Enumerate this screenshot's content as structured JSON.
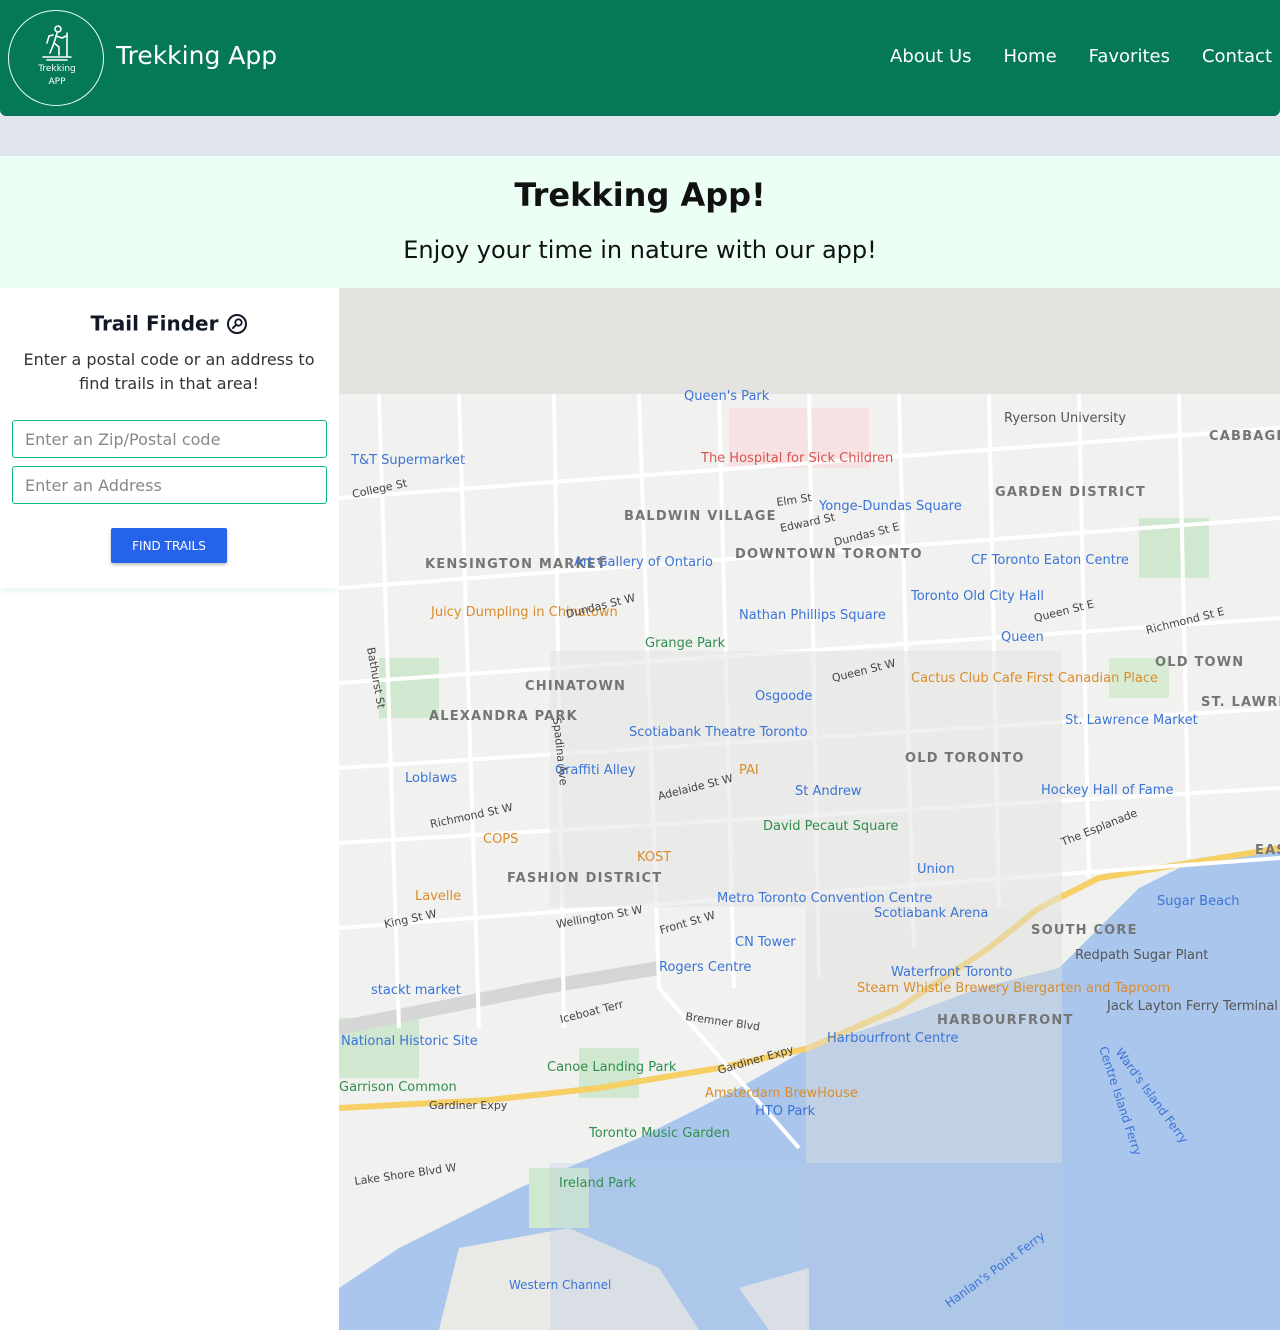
{
  "header": {
    "logo_line1": "Trekking",
    "logo_line2": "APP",
    "brand": "Trekking App",
    "nav": [
      "About Us",
      "Home",
      "Favorites",
      "Contact"
    ]
  },
  "hero": {
    "title": "Trekking App!",
    "subtitle": "Enjoy your time in nature with our app!"
  },
  "sidebar": {
    "title": "Trail Finder",
    "description": "Enter a postal code or an address to find trails in that area!",
    "zip_placeholder": "Enter an Zip/Postal code",
    "address_placeholder": "Enter an Address",
    "button": "FIND TRAILS"
  },
  "map": {
    "labels": {
      "queens_park": "Queen's Park",
      "ryerson": "Ryerson University",
      "cabbagetown": "CABBAGETOWN SOUTH",
      "tt_supermarket": "T&T Supermarket",
      "hospital_sick": "The Hospital for Sick Children",
      "college_st": "College St",
      "elm_st": "Elm St",
      "baldwin": "BALDWIN VILLAGE",
      "yonge_dundas": "Yonge-Dundas Square",
      "garden_district": "GARDEN DISTRICT",
      "kensington": "KENSINGTON MARKET",
      "downtown": "DOWNTOWN TORONTO",
      "ago": "Art Gallery of Ontario",
      "eaton": "CF Toronto Eaton Centre",
      "juicy": "Juicy Dumpling in Chinatown",
      "old_city_hall": "Toronto Old City Hall",
      "nathan_phillips": "Nathan Phillips Square",
      "grange_park": "Grange Park",
      "queen_station": "Queen",
      "old_town": "OLD TOWN",
      "chinatown": "CHINATOWN",
      "cactus": "Cactus Club Cafe First Canadian Place",
      "st_lawrence": "ST. LAWRENCE",
      "alexandra_park": "ALEXANDRA PARK",
      "osgoode": "Osgoode",
      "st_lawrence_market": "St. Lawrence Market",
      "scotiabank_theatre": "Scotiabank Theatre Toronto",
      "old_toronto": "OLD TORONTO",
      "loblaws": "Loblaws",
      "graffiti": "Graffiti Alley",
      "pai": "PAI",
      "hockey": "Hockey Hall of Fame",
      "st_andrew": "St Andrew",
      "richmond": "Richmond St W",
      "cops": "COPS",
      "david_pecaut": "David Pecaut Square",
      "kost": "KOST",
      "union": "Union",
      "east": "EAST",
      "fashion": "FASHION DISTRICT",
      "lavelle": "Lavelle",
      "sugar_beach": "Sugar Beach",
      "metro": "Metro Toronto Convention Centre",
      "scotiabank_arena": "Scotiabank Arena",
      "south_core": "SOUTH CORE",
      "king_st": "King St W",
      "cn_tower": "CN Tower",
      "redpath": "Redpath Sugar Plant",
      "rogers": "Rogers Centre",
      "waterfront": "Waterfront Toronto",
      "stackt": "stackt market",
      "steam_whistle": "Steam Whistle Brewery Biergarten and Taproom",
      "jack_layton": "Jack Layton Ferry Terminal",
      "harbourfront": "HARBOURFRONT",
      "national": "National Historic Site",
      "harbourfront_centre": "Harbourfront Centre",
      "canoe": "Canoe Landing Park",
      "garrison": "Garrison Common",
      "gardiner": "Gardiner Expy",
      "amsterdam": "Amsterdam BrewHouse",
      "hto": "HTO Park",
      "music_garden": "Toronto Music Garden",
      "lakeshore": "Lake Shore Blvd W",
      "ireland_park": "Ireland Park",
      "western_channel": "Western Channel",
      "bremner": "Bremner Blvd",
      "front_st": "Front St W",
      "dundas_st": "Dundas St W",
      "queen_st": "Queen St W",
      "adelaide": "Adelaide St W",
      "wellington": "Wellington St W",
      "queen_e": "Queen St E",
      "richmond_e": "Richmond St E",
      "dundas_e": "Dundas St E",
      "hanlans": "Hanlan's Point Ferry",
      "wards": "Ward's Island Ferry",
      "centre_island": "Centre Island Ferry",
      "bathurst": "Bathurst St",
      "spadina": "Spadina Ave",
      "edward": "Edward St",
      "iceboat": "Iceboat Terr",
      "the_esplanade": "The Esplanade"
    }
  },
  "colors": {
    "header": "#047857",
    "hero_bg": "#ebfff5",
    "band": "#e1e5ee",
    "button": "#2563eb",
    "input_border": "#10b981",
    "water": "#aac6ec",
    "land": "#f1f1ef"
  },
  "icons": [
    "hiker-logo-icon",
    "search-icon"
  ]
}
